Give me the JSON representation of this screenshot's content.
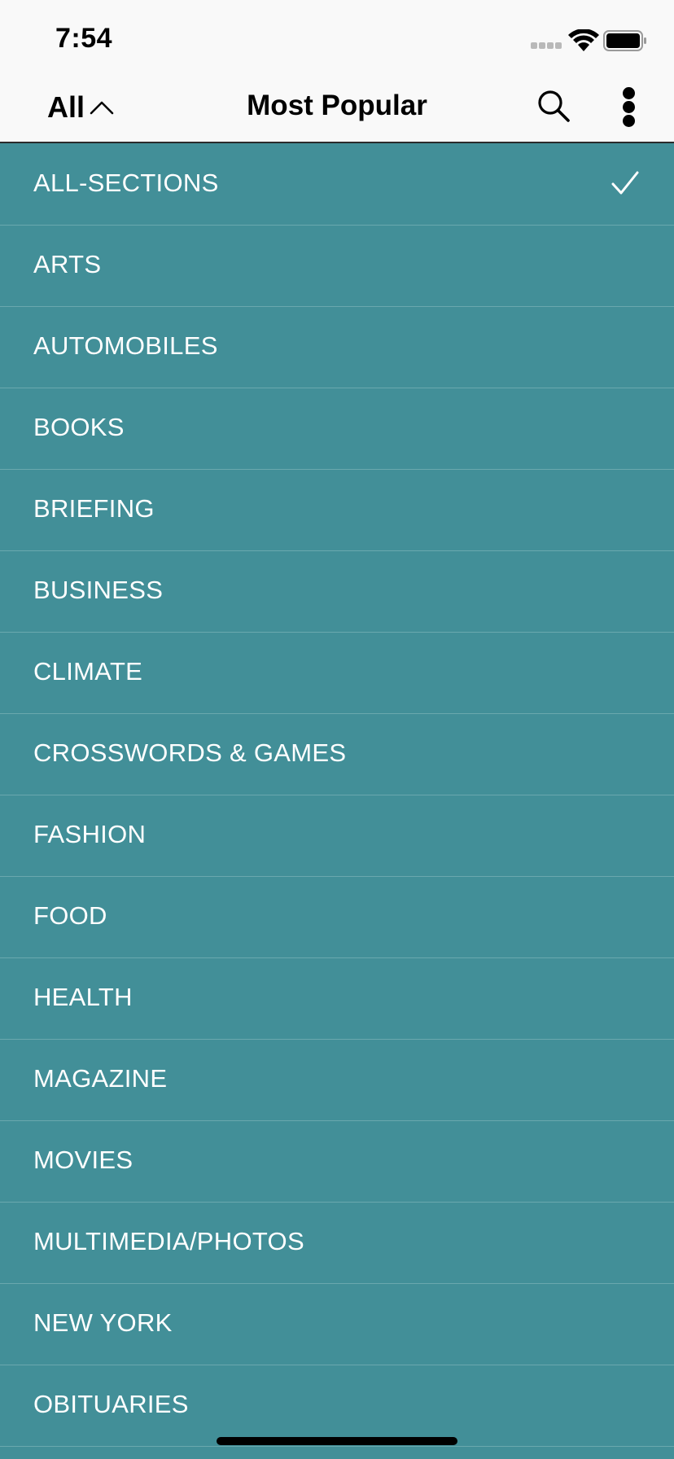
{
  "status_bar": {
    "time": "7:54",
    "icons": [
      "cellular-signal-icon",
      "wifi-icon",
      "battery-icon"
    ]
  },
  "nav": {
    "section_toggle_label": "All",
    "section_toggle_icon": "chevron-up-icon",
    "title": "Most Popular",
    "search_icon": "search-icon",
    "more_icon": "more-vertical-icon"
  },
  "colors": {
    "list_background": "#428f98",
    "list_divider": "#6aa8ae",
    "list_text": "#ffffff",
    "bar_background": "#f9f9f9"
  },
  "sections": [
    {
      "label": "ALL-SECTIONS",
      "selected": true
    },
    {
      "label": "ARTS",
      "selected": false
    },
    {
      "label": "AUTOMOBILES",
      "selected": false
    },
    {
      "label": "BOOKS",
      "selected": false
    },
    {
      "label": "BRIEFING",
      "selected": false
    },
    {
      "label": "BUSINESS",
      "selected": false
    },
    {
      "label": "CLIMATE",
      "selected": false
    },
    {
      "label": "CROSSWORDS & GAMES",
      "selected": false
    },
    {
      "label": "FASHION",
      "selected": false
    },
    {
      "label": "FOOD",
      "selected": false
    },
    {
      "label": "HEALTH",
      "selected": false
    },
    {
      "label": "MAGAZINE",
      "selected": false
    },
    {
      "label": "MOVIES",
      "selected": false
    },
    {
      "label": "MULTIMEDIA/PHOTOS",
      "selected": false
    },
    {
      "label": "NEW YORK",
      "selected": false
    },
    {
      "label": "OBITUARIES",
      "selected": false
    },
    {
      "label": "",
      "selected": false
    }
  ]
}
